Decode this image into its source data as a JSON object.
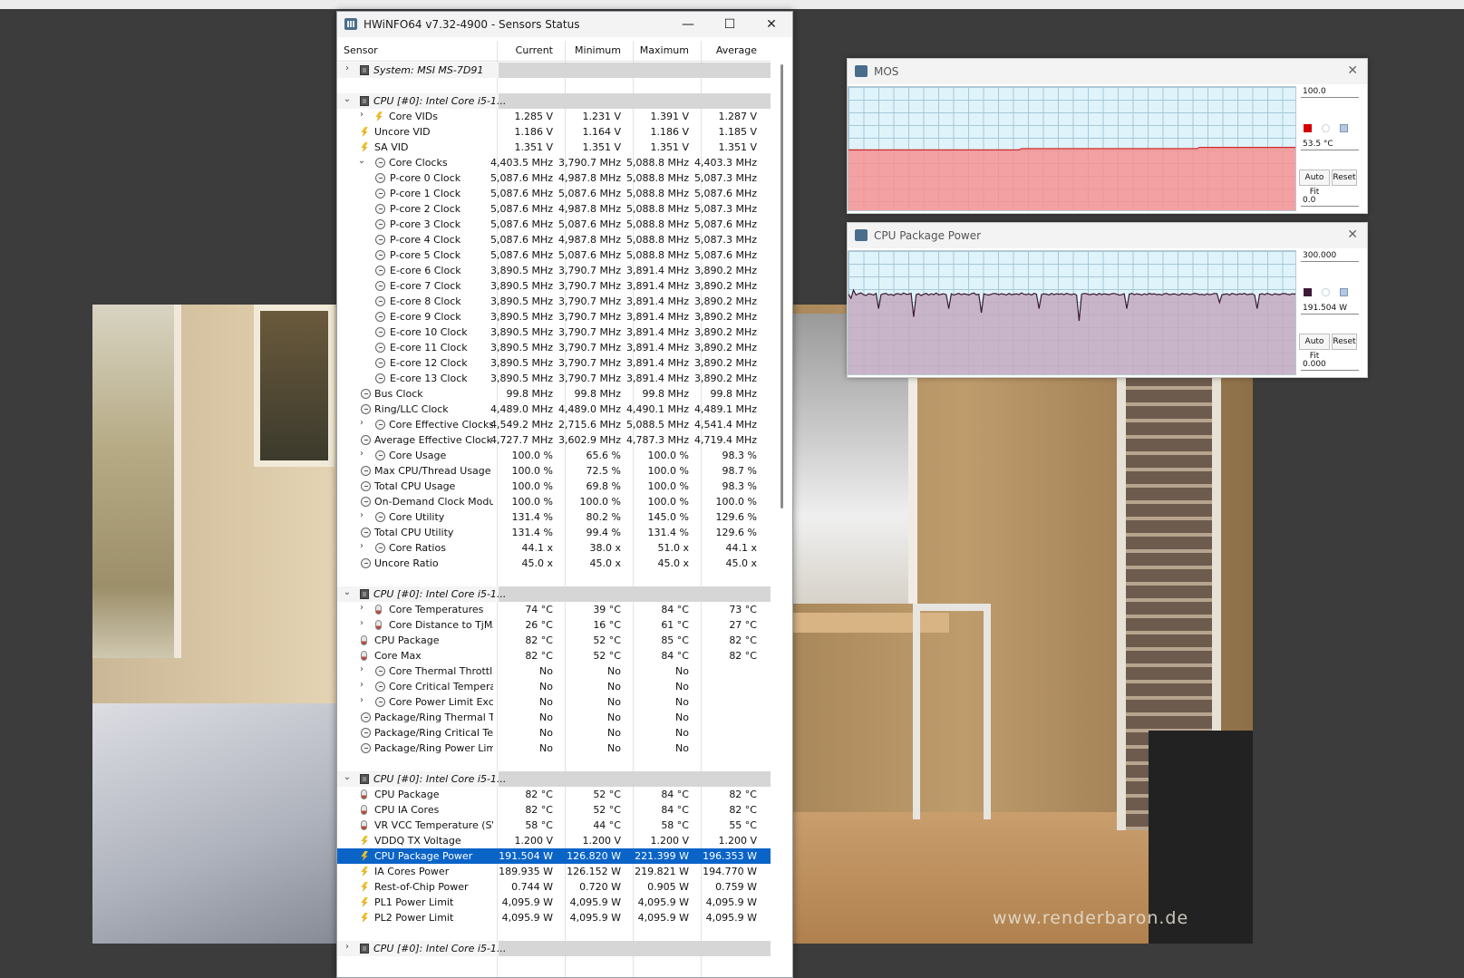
{
  "watermark": "www.renderbaron.de",
  "window": {
    "title": "HWiNFO64 v7.32-4900 - Sensors Status",
    "controls": {
      "minimize": "—",
      "maximize": "☐",
      "close": "✕"
    }
  },
  "columns": [
    "Sensor",
    "Current",
    "Minimum",
    "Maximum",
    "Average"
  ],
  "rows": [
    {
      "type": "group",
      "expand": ">",
      "label": "System: MSI MS-7D91",
      "icon": "chip-icon"
    },
    {
      "type": "blank"
    },
    {
      "type": "group",
      "expand": "v",
      "label": "CPU [#0]: Intel Core i5-1...",
      "icon": "chip-icon"
    },
    {
      "indent": 1,
      "expand": ">",
      "icon": "volt-icon",
      "label": "Core VIDs",
      "cur": "1.285 V",
      "min": "1.231 V",
      "max": "1.391 V",
      "avg": "1.287 V"
    },
    {
      "indent": 0,
      "icon": "volt-icon",
      "label": "Uncore VID",
      "cur": "1.186 V",
      "min": "1.164 V",
      "max": "1.186 V",
      "avg": "1.185 V"
    },
    {
      "indent": 0,
      "icon": "volt-icon",
      "label": "SA VID",
      "cur": "1.351 V",
      "min": "1.351 V",
      "max": "1.351 V",
      "avg": "1.351 V"
    },
    {
      "indent": 1,
      "expand": "v",
      "icon": "clock-icon",
      "label": "Core Clocks",
      "cur": "4,403.5 MHz",
      "min": "3,790.7 MHz",
      "max": "5,088.8 MHz",
      "avg": "4,403.3 MHz"
    },
    {
      "indent": 2,
      "icon": "clock-icon",
      "label": "P-core 0 Clock",
      "cur": "5,087.6 MHz",
      "min": "4,987.8 MHz",
      "max": "5,088.8 MHz",
      "avg": "5,087.3 MHz"
    },
    {
      "indent": 2,
      "icon": "clock-icon",
      "label": "P-core 1 Clock",
      "cur": "5,087.6 MHz",
      "min": "5,087.6 MHz",
      "max": "5,088.8 MHz",
      "avg": "5,087.6 MHz"
    },
    {
      "indent": 2,
      "icon": "clock-icon",
      "label": "P-core 2 Clock",
      "cur": "5,087.6 MHz",
      "min": "4,987.8 MHz",
      "max": "5,088.8 MHz",
      "avg": "5,087.3 MHz"
    },
    {
      "indent": 2,
      "icon": "clock-icon",
      "label": "P-core 3 Clock",
      "cur": "5,087.6 MHz",
      "min": "5,087.6 MHz",
      "max": "5,088.8 MHz",
      "avg": "5,087.6 MHz"
    },
    {
      "indent": 2,
      "icon": "clock-icon",
      "label": "P-core 4 Clock",
      "cur": "5,087.6 MHz",
      "min": "4,987.8 MHz",
      "max": "5,088.8 MHz",
      "avg": "5,087.3 MHz"
    },
    {
      "indent": 2,
      "icon": "clock-icon",
      "label": "P-core 5 Clock",
      "cur": "5,087.6 MHz",
      "min": "5,087.6 MHz",
      "max": "5,088.8 MHz",
      "avg": "5,087.6 MHz"
    },
    {
      "indent": 2,
      "icon": "clock-icon",
      "label": "E-core 6 Clock",
      "cur": "3,890.5 MHz",
      "min": "3,790.7 MHz",
      "max": "3,891.4 MHz",
      "avg": "3,890.2 MHz"
    },
    {
      "indent": 2,
      "icon": "clock-icon",
      "label": "E-core 7 Clock",
      "cur": "3,890.5 MHz",
      "min": "3,790.7 MHz",
      "max": "3,891.4 MHz",
      "avg": "3,890.2 MHz"
    },
    {
      "indent": 2,
      "icon": "clock-icon",
      "label": "E-core 8 Clock",
      "cur": "3,890.5 MHz",
      "min": "3,790.7 MHz",
      "max": "3,891.4 MHz",
      "avg": "3,890.2 MHz"
    },
    {
      "indent": 2,
      "icon": "clock-icon",
      "label": "E-core 9 Clock",
      "cur": "3,890.5 MHz",
      "min": "3,790.7 MHz",
      "max": "3,891.4 MHz",
      "avg": "3,890.2 MHz"
    },
    {
      "indent": 2,
      "icon": "clock-icon",
      "label": "E-core 10 Clock",
      "cur": "3,890.5 MHz",
      "min": "3,790.7 MHz",
      "max": "3,891.4 MHz",
      "avg": "3,890.2 MHz"
    },
    {
      "indent": 2,
      "icon": "clock-icon",
      "label": "E-core 11 Clock",
      "cur": "3,890.5 MHz",
      "min": "3,790.7 MHz",
      "max": "3,891.4 MHz",
      "avg": "3,890.2 MHz"
    },
    {
      "indent": 2,
      "icon": "clock-icon",
      "label": "E-core 12 Clock",
      "cur": "3,890.5 MHz",
      "min": "3,790.7 MHz",
      "max": "3,891.4 MHz",
      "avg": "3,890.2 MHz"
    },
    {
      "indent": 2,
      "icon": "clock-icon",
      "label": "E-core 13 Clock",
      "cur": "3,890.5 MHz",
      "min": "3,790.7 MHz",
      "max": "3,891.4 MHz",
      "avg": "3,890.2 MHz"
    },
    {
      "indent": 0,
      "icon": "clock-icon",
      "label": "Bus Clock",
      "cur": "99.8 MHz",
      "min": "99.8 MHz",
      "max": "99.8 MHz",
      "avg": "99.8 MHz"
    },
    {
      "indent": 0,
      "icon": "clock-icon",
      "label": "Ring/LLC Clock",
      "cur": "4,489.0 MHz",
      "min": "4,489.0 MHz",
      "max": "4,490.1 MHz",
      "avg": "4,489.1 MHz"
    },
    {
      "indent": 1,
      "expand": ">",
      "icon": "clock-icon",
      "label": "Core Effective Clocks",
      "cur": "4,549.2 MHz",
      "min": "2,715.6 MHz",
      "max": "5,088.5 MHz",
      "avg": "4,541.4 MHz"
    },
    {
      "indent": 0,
      "icon": "clock-icon",
      "label": "Average Effective Clock",
      "cur": "4,727.7 MHz",
      "min": "3,602.9 MHz",
      "max": "4,787.3 MHz",
      "avg": "4,719.4 MHz"
    },
    {
      "indent": 1,
      "expand": ">",
      "icon": "clock-icon",
      "label": "Core Usage",
      "cur": "100.0 %",
      "min": "65.6 %",
      "max": "100.0 %",
      "avg": "98.3 %"
    },
    {
      "indent": 0,
      "icon": "clock-icon",
      "label": "Max CPU/Thread Usage",
      "cur": "100.0 %",
      "min": "72.5 %",
      "max": "100.0 %",
      "avg": "98.7 %"
    },
    {
      "indent": 0,
      "icon": "clock-icon",
      "label": "Total CPU Usage",
      "cur": "100.0 %",
      "min": "69.8 %",
      "max": "100.0 %",
      "avg": "98.3 %"
    },
    {
      "indent": 0,
      "icon": "clock-icon",
      "label": "On-Demand Clock Modul...",
      "cur": "100.0 %",
      "min": "100.0 %",
      "max": "100.0 %",
      "avg": "100.0 %"
    },
    {
      "indent": 1,
      "expand": ">",
      "icon": "clock-icon",
      "label": "Core Utility",
      "cur": "131.4 %",
      "min": "80.2 %",
      "max": "145.0 %",
      "avg": "129.6 %"
    },
    {
      "indent": 0,
      "icon": "clock-icon",
      "label": "Total CPU Utility",
      "cur": "131.4 %",
      "min": "99.4 %",
      "max": "131.4 %",
      "avg": "129.6 %"
    },
    {
      "indent": 1,
      "expand": ">",
      "icon": "clock-icon",
      "label": "Core Ratios",
      "cur": "44.1 x",
      "min": "38.0 x",
      "max": "51.0 x",
      "avg": "44.1 x"
    },
    {
      "indent": 0,
      "icon": "clock-icon",
      "label": "Uncore Ratio",
      "cur": "45.0 x",
      "min": "45.0 x",
      "max": "45.0 x",
      "avg": "45.0 x"
    },
    {
      "type": "blank"
    },
    {
      "type": "group",
      "expand": "v",
      "label": "CPU [#0]: Intel Core i5-1...",
      "icon": "chip-icon"
    },
    {
      "indent": 1,
      "expand": ">",
      "icon": "temp-icon",
      "label": "Core Temperatures",
      "cur": "74 °C",
      "min": "39 °C",
      "max": "84 °C",
      "avg": "73 °C"
    },
    {
      "indent": 1,
      "expand": ">",
      "icon": "temp-icon",
      "label": "Core Distance to TjMAX",
      "cur": "26 °C",
      "min": "16 °C",
      "max": "61 °C",
      "avg": "27 °C"
    },
    {
      "indent": 0,
      "icon": "temp-icon",
      "label": "CPU Package",
      "cur": "82 °C",
      "min": "52 °C",
      "max": "85 °C",
      "avg": "82 °C"
    },
    {
      "indent": 0,
      "icon": "temp-icon",
      "label": "Core Max",
      "cur": "82 °C",
      "min": "52 °C",
      "max": "84 °C",
      "avg": "82 °C"
    },
    {
      "indent": 1,
      "expand": ">",
      "icon": "clock-icon",
      "label": "Core Thermal Throttling",
      "cur": "No",
      "min": "No",
      "max": "No",
      "avg": ""
    },
    {
      "indent": 1,
      "expand": ">",
      "icon": "clock-icon",
      "label": "Core Critical Tempera...",
      "cur": "No",
      "min": "No",
      "max": "No",
      "avg": ""
    },
    {
      "indent": 1,
      "expand": ">",
      "icon": "clock-icon",
      "label": "Core Power Limit Exc...",
      "cur": "No",
      "min": "No",
      "max": "No",
      "avg": ""
    },
    {
      "indent": 0,
      "icon": "clock-icon",
      "label": "Package/Ring Thermal Th...",
      "cur": "No",
      "min": "No",
      "max": "No",
      "avg": ""
    },
    {
      "indent": 0,
      "icon": "clock-icon",
      "label": "Package/Ring Critical Te...",
      "cur": "No",
      "min": "No",
      "max": "No",
      "avg": ""
    },
    {
      "indent": 0,
      "icon": "clock-icon",
      "label": "Package/Ring Power Limi...",
      "cur": "No",
      "min": "No",
      "max": "No",
      "avg": ""
    },
    {
      "type": "blank"
    },
    {
      "type": "group",
      "expand": "v",
      "label": "CPU [#0]: Intel Core i5-1...",
      "icon": "chip-icon"
    },
    {
      "indent": 0,
      "icon": "temp-icon",
      "label": "CPU Package",
      "cur": "82 °C",
      "min": "52 °C",
      "max": "84 °C",
      "avg": "82 °C"
    },
    {
      "indent": 0,
      "icon": "temp-icon",
      "label": "CPU IA Cores",
      "cur": "82 °C",
      "min": "52 °C",
      "max": "84 °C",
      "avg": "82 °C"
    },
    {
      "indent": 0,
      "icon": "temp-icon",
      "label": "VR VCC Temperature (SV...",
      "cur": "58 °C",
      "min": "44 °C",
      "max": "58 °C",
      "avg": "55 °C"
    },
    {
      "indent": 0,
      "icon": "volt-icon",
      "label": "VDDQ TX Voltage",
      "cur": "1.200 V",
      "min": "1.200 V",
      "max": "1.200 V",
      "avg": "1.200 V"
    },
    {
      "indent": 0,
      "icon": "volt-icon",
      "label": "CPU Package Power",
      "cur": "191.504 W",
      "min": "126.820 W",
      "max": "221.399 W",
      "avg": "196.353 W",
      "selected": true
    },
    {
      "indent": 0,
      "icon": "volt-icon",
      "label": "IA Cores Power",
      "cur": "189.935 W",
      "min": "126.152 W",
      "max": "219.821 W",
      "avg": "194.770 W"
    },
    {
      "indent": 0,
      "icon": "volt-icon",
      "label": "Rest-of-Chip Power",
      "cur": "0.744 W",
      "min": "0.720 W",
      "max": "0.905 W",
      "avg": "0.759 W"
    },
    {
      "indent": 0,
      "icon": "volt-icon",
      "label": "PL1 Power Limit",
      "cur": "4,095.9 W",
      "min": "4,095.9 W",
      "max": "4,095.9 W",
      "avg": "4,095.9 W"
    },
    {
      "indent": 0,
      "icon": "volt-icon",
      "label": "PL2 Power Limit",
      "cur": "4,095.9 W",
      "min": "4,095.9 W",
      "max": "4,095.9 W",
      "avg": "4,095.9 W"
    },
    {
      "type": "blank"
    },
    {
      "type": "group",
      "expand": ">",
      "label": "CPU [#0]: Intel Core i5-1...",
      "icon": "chip-icon"
    }
  ],
  "graphs": [
    {
      "title": "MOS",
      "max_label": "100.0",
      "current_label": "53.5 °C",
      "min_label": "0.0",
      "autofit_label": "Auto Fit",
      "reset_label": "Reset",
      "fill_color": "#f79292",
      "line_color": "#d42a2a",
      "swatch_color": "#d40000",
      "ymax": 100,
      "values": [
        49,
        49,
        49,
        49,
        49,
        49,
        49,
        49,
        49,
        49,
        49,
        49,
        49,
        49,
        49,
        49,
        49,
        49,
        49,
        49,
        49,
        49,
        49,
        49,
        49,
        49,
        49,
        49,
        49,
        49,
        49,
        49,
        49,
        49,
        49,
        49,
        49,
        49,
        49,
        49,
        49,
        49,
        49,
        49,
        49,
        49,
        49,
        49,
        49,
        49,
        49,
        49,
        49,
        49,
        49,
        49,
        49,
        49,
        49,
        49,
        49,
        49,
        49,
        49,
        49,
        49,
        49,
        49,
        49,
        50,
        50,
        50,
        50,
        50,
        50,
        50,
        50,
        50,
        50,
        50,
        50,
        50,
        50,
        50,
        50,
        50,
        50,
        50,
        50,
        50,
        50,
        50,
        50,
        50,
        50,
        50,
        50,
        50,
        50,
        50,
        50,
        50,
        50,
        50,
        50,
        50,
        50,
        50,
        50,
        50,
        50,
        50,
        50,
        50,
        50,
        50,
        50,
        50,
        50,
        50,
        50,
        50,
        50,
        50,
        50,
        50,
        50,
        50,
        50,
        50,
        50,
        50,
        50,
        50,
        50,
        50,
        50,
        50,
        50,
        50,
        51,
        51,
        51,
        51,
        51,
        51,
        51,
        51,
        51,
        51,
        51,
        51,
        51,
        51,
        51,
        51,
        51,
        51,
        51,
        51,
        51,
        51,
        51,
        51,
        51,
        51,
        51,
        51,
        51,
        51,
        51,
        51,
        51,
        51,
        51,
        51,
        51,
        51,
        51,
        51
      ]
    },
    {
      "title": "CPU Package Power",
      "max_label": "300.000",
      "current_label": "191.504 W",
      "min_label": "0.000",
      "autofit_label": "Auto Fit",
      "reset_label": "Reset",
      "fill_color": "#c4a9c0",
      "line_color": "#3b1a34",
      "swatch_color": "#3c1a38",
      "ymax": 300,
      "values": [
        195,
        185,
        205,
        193,
        196,
        198,
        194,
        192,
        196,
        195,
        193,
        197,
        160,
        194,
        196,
        197,
        193,
        195,
        192,
        196,
        196,
        194,
        198,
        195,
        195,
        197,
        140,
        194,
        196,
        192,
        195,
        197,
        193,
        196,
        194,
        198,
        193,
        195,
        196,
        194,
        160,
        196,
        193,
        195,
        197,
        194,
        196,
        195,
        193,
        196,
        198,
        194,
        195,
        150,
        196,
        194,
        193,
        195,
        197,
        196,
        194,
        196,
        195,
        193,
        197,
        194,
        195,
        196,
        194,
        198,
        195,
        194,
        196,
        193,
        197,
        195,
        160,
        194,
        196,
        195,
        193,
        197,
        194,
        196,
        195,
        196,
        194,
        197,
        195,
        194,
        196,
        193,
        130,
        195,
        197,
        196,
        194,
        195,
        196,
        193,
        197,
        194,
        196,
        195,
        194,
        196,
        197,
        195,
        193,
        194,
        196,
        160,
        195,
        197,
        194,
        196,
        195,
        193,
        196,
        194,
        197,
        195,
        196,
        194,
        195,
        193,
        196,
        197,
        194,
        195,
        196,
        194,
        193,
        197,
        195,
        196,
        194,
        195,
        197,
        196,
        194,
        195,
        193,
        196,
        194,
        195,
        197,
        196,
        175,
        194,
        195,
        196,
        193,
        197,
        195,
        194,
        196,
        195,
        197,
        194,
        195,
        196,
        193,
        160,
        195,
        196,
        194,
        197,
        195,
        193,
        196,
        195,
        194,
        196,
        197,
        195,
        194,
        196,
        195,
        200
      ]
    }
  ]
}
